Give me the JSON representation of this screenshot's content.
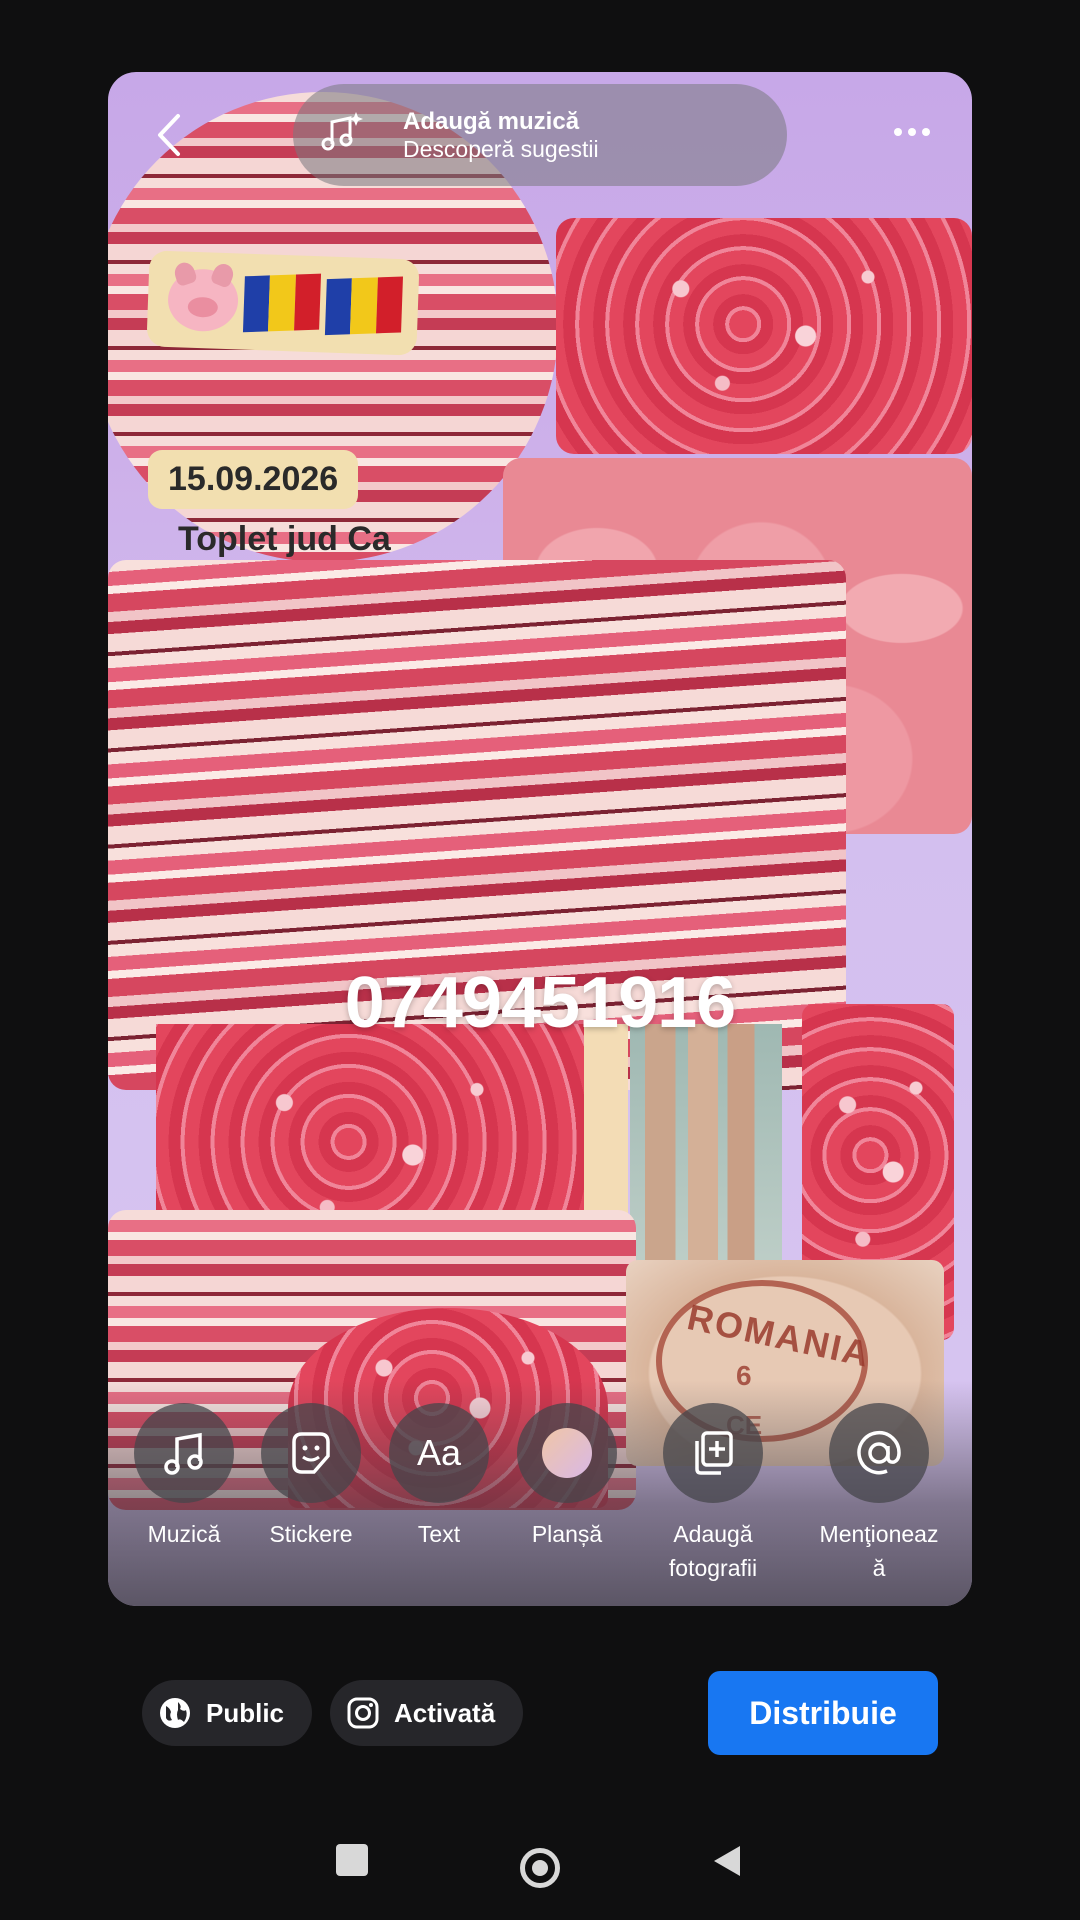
{
  "header": {
    "music_title": "Adaugă muzică",
    "music_subtitle": "Descoperă sugestii"
  },
  "collage": {
    "date_badge": "15.09.2026",
    "location_text": "Toplet jud Ca",
    "phone_text": "0749451916",
    "stamp_text": "ROMANIA",
    "stamp_number": "6",
    "stamp_sub": "CE"
  },
  "tools": [
    {
      "label": "Muzică",
      "icon": "music-note-icon"
    },
    {
      "label": "Stickere",
      "icon": "sticker-icon"
    },
    {
      "label": "Text",
      "icon": "text-aa-icon"
    },
    {
      "label": "Planșă",
      "icon": "background-color-icon"
    },
    {
      "label": "Adaugă\nfotografii",
      "icon": "add-photos-icon"
    },
    {
      "label": "Menţioneaz\nă",
      "icon": "mention-at-icon"
    }
  ],
  "bottom_bar": {
    "audience_label": "Public",
    "instagram_label": "Activată",
    "share_label": "Distribuie"
  },
  "colors": {
    "share_button": "#1877f2",
    "background": "#0f0f10",
    "card_bg": "#cdb0ea"
  }
}
